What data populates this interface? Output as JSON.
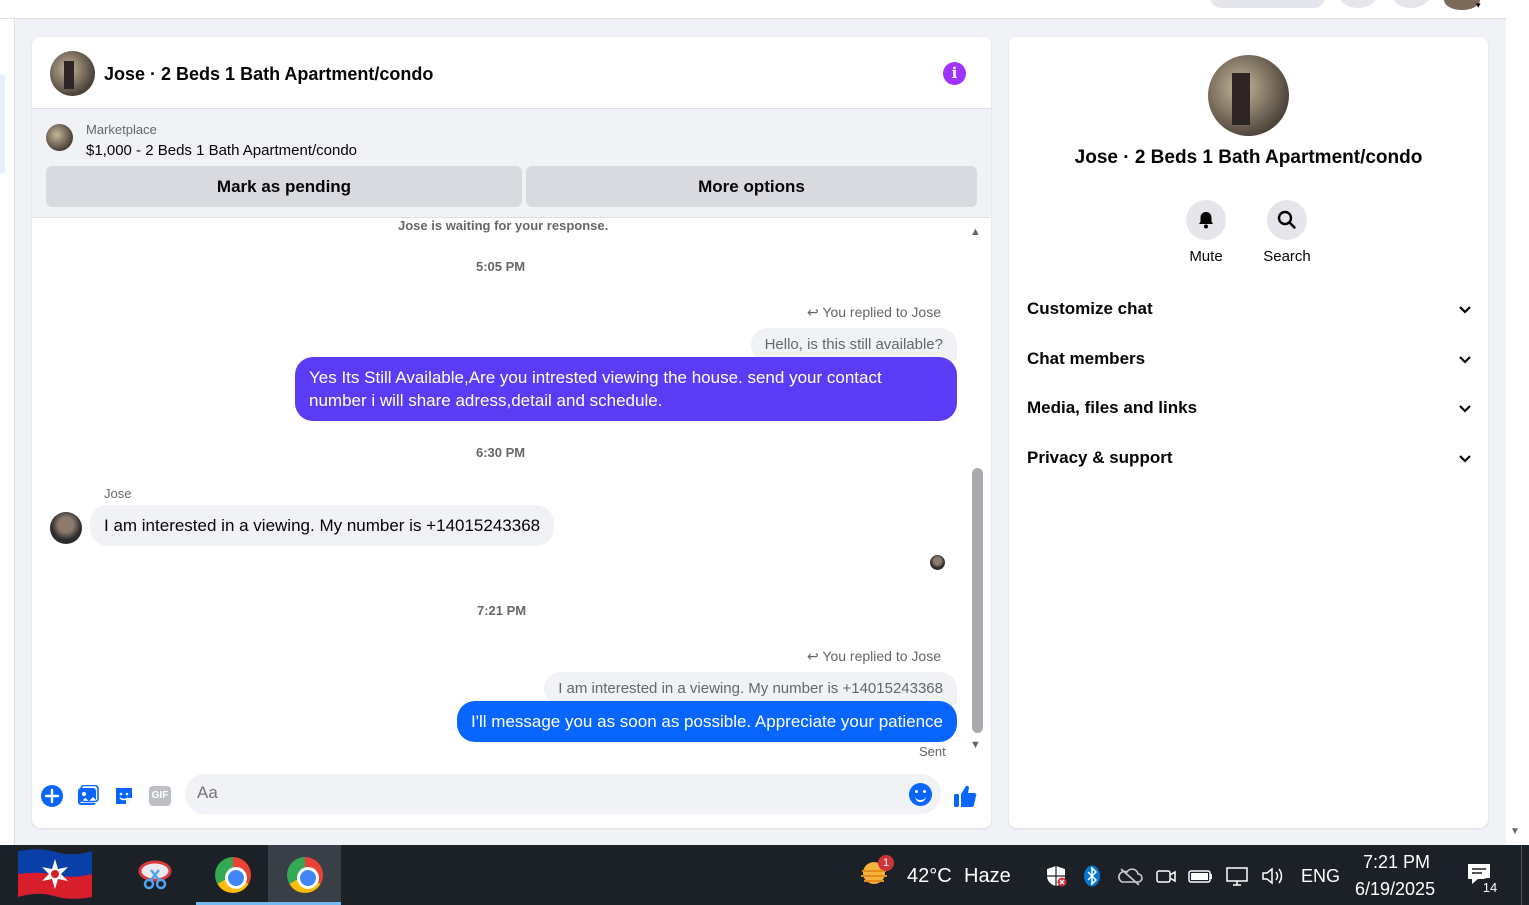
{
  "chat": {
    "title": "Jose · 2 Beds 1 Bath Apartment/condo",
    "marketplace_label": "Marketplace",
    "listing": "$1,000 - 2 Beds 1 Bath Apartment/condo",
    "mark_pending_label": "Mark as pending",
    "more_options_label": "More options",
    "waiting_notice": "Jose is waiting for your response.",
    "messages": {
      "time1": "5:05 PM",
      "replied1": "You replied to Jose",
      "quote1": "Hello, is this still available?",
      "out1": "Yes Its Still Available,Are you intrested viewing the house. send your contact number i will share adress,detail and schedule.",
      "time2": "6:30 PM",
      "sender2": "Jose",
      "in1": "I am interested in a viewing. My number is +14015243368",
      "time3": "7:21 PM",
      "replied2": "You replied to Jose",
      "quote2": "I am interested in a viewing. My number is +14015243368",
      "out2": "I'll message you as soon as possible. Appreciate your patience",
      "sent_status": "Sent"
    },
    "composer": {
      "placeholder": "Aa",
      "gif_label": "GIF"
    },
    "colors": {
      "bubble_purple": "#5b3cf5",
      "bubble_blue": "#0866ff",
      "info_icon": "#a033ff"
    }
  },
  "info_panel": {
    "name": "Jose · 2 Beds 1 Bath Apartment/condo",
    "actions": [
      {
        "label": "Mute",
        "icon": "bell-icon"
      },
      {
        "label": "Search",
        "icon": "search-icon"
      }
    ],
    "sections": [
      {
        "label": "Customize chat"
      },
      {
        "label": "Chat members"
      },
      {
        "label": "Media, files and links"
      },
      {
        "label": "Privacy & support"
      }
    ]
  },
  "taskbar": {
    "weather_temp": "42°C",
    "weather_desc": "Haze",
    "weather_badge": "1",
    "language": "ENG",
    "time": "7:21 PM",
    "date": "6/19/2025",
    "notification_count": "14"
  }
}
